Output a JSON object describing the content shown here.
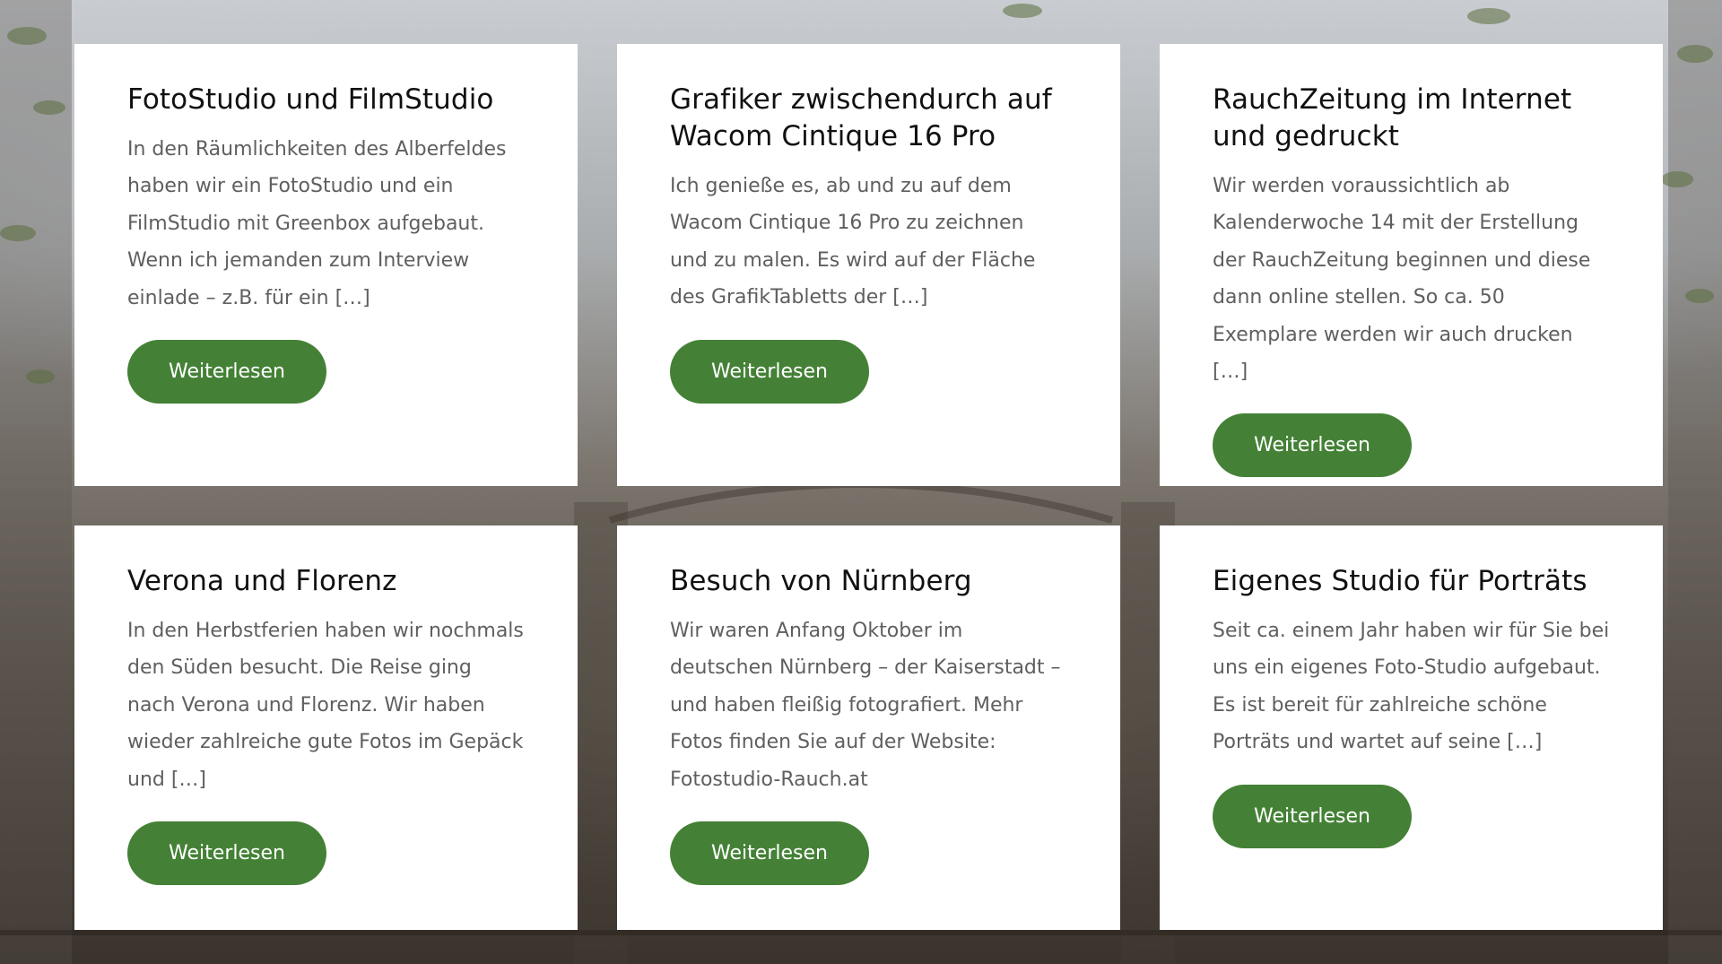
{
  "theme": {
    "accent": "#448136",
    "card_background": "#ffffff",
    "title_color": "#111111",
    "text_color": "#5f5f5f"
  },
  "posts": [
    {
      "title": "FotoStudio und FilmStudio",
      "excerpt": "In den Räumlichkeiten des Alberfeldes haben wir ein FotoStudio und ein FilmStudio mit Greenbox aufgebaut. Wenn ich jemanden zum Interview einlade – z.B. für ein […]",
      "button": "Weiterlesen"
    },
    {
      "title": "Grafiker zwischendurch auf Wacom Cintique 16 Pro",
      "excerpt": "Ich genieße es, ab und zu auf dem Wacom Cintique 16 Pro zu zeichnen und zu malen. Es wird auf der Fläche des GrafikTabletts der […]",
      "button": "Weiterlesen"
    },
    {
      "title": "RauchZeitung im Internet und gedruckt",
      "excerpt": "Wir werden voraussichtlich ab Kalenderwoche 14 mit der Erstellung der RauchZeitung beginnen und diese dann online stellen. So ca. 50 Exemplare werden wir auch drucken […]",
      "button": "Weiterlesen"
    },
    {
      "title": "Verona und Florenz",
      "excerpt": "In den Herbstferien haben wir nochmals den Süden besucht. Die Reise ging nach Verona und Florenz. Wir haben wieder zahlreiche gute Fotos im Gepäck und […]",
      "button": "Weiterlesen"
    },
    {
      "title": "Besuch von Nürnberg",
      "excerpt": "Wir waren Anfang Oktober im deutschen Nürnberg – der Kaiserstadt – und haben fleißig fotografiert. Mehr Fotos finden Sie auf der Website: Fotostudio-Rauch.at",
      "button": "Weiterlesen"
    },
    {
      "title": "Eigenes Studio für Porträts",
      "excerpt": "Seit ca. einem Jahr haben wir für Sie bei uns ein eigenes Foto-Studio aufgebaut. Es ist bereit für zahlreiche schöne Porträts und wartet auf seine […]",
      "button": "Weiterlesen"
    }
  ]
}
